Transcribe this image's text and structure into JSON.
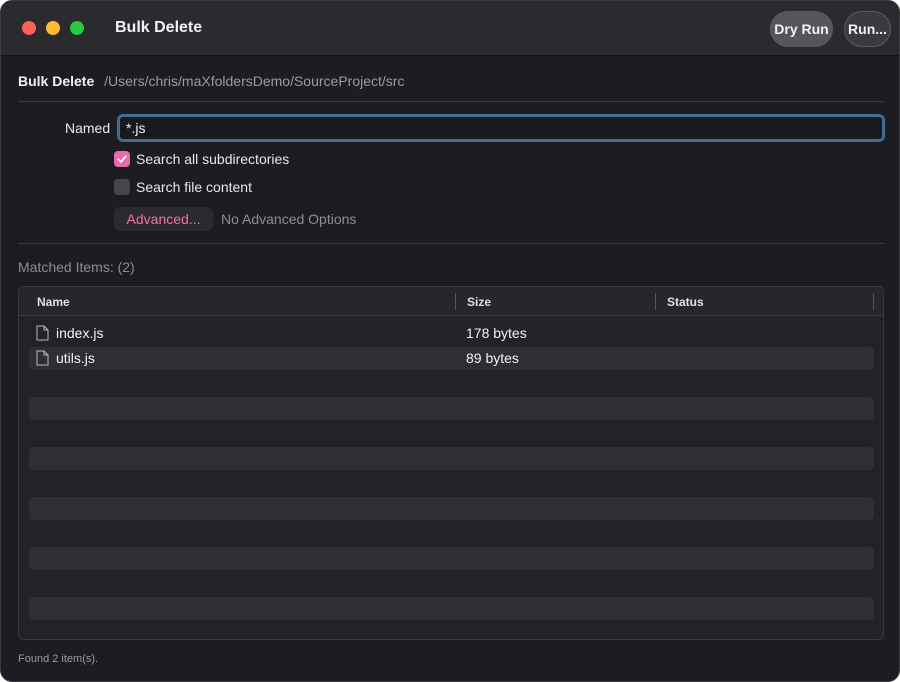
{
  "window": {
    "title": "Bulk Delete",
    "buttons": {
      "dry_run": "Dry Run",
      "run": "Run..."
    }
  },
  "pathbar": {
    "label": "Bulk Delete",
    "path": "/Users/chris/maXfoldersDemo/SourceProject/src"
  },
  "form": {
    "named_label": "Named",
    "named_value": "*.js",
    "options": [
      {
        "label": "Search all subdirectories",
        "checked": true
      },
      {
        "label": "Search file content",
        "checked": false
      }
    ],
    "advanced_button": "Advanced...",
    "advanced_note": "No Advanced Options"
  },
  "results": {
    "matched_label": "Matched Items: (2)",
    "columns": [
      "Name",
      "Size",
      "Status"
    ],
    "rows": [
      {
        "name": "index.js",
        "size": "178 bytes",
        "status": "",
        "icon": "file-icon"
      },
      {
        "name": "utils.js",
        "size": "89 bytes",
        "status": "",
        "icon": "file-icon"
      }
    ]
  },
  "footer": {
    "status": "Found 2 item(s)."
  },
  "colors": {
    "accent": "#e96aa4",
    "focus_ring": "#3f6e95"
  }
}
